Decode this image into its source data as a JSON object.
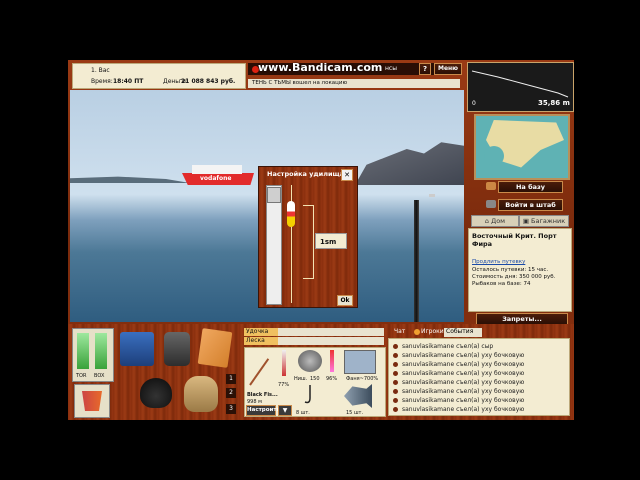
{
  "watermark": "www.Bandicam.com",
  "topbar": {
    "rank": "1. Вас",
    "time_label": "Время:",
    "time_value": "18:40 ПТ",
    "money_label": "Деньги:",
    "money_value": "21 088 843 руб.",
    "tab_partial": "нсы",
    "help_label": "?",
    "menu_label": "Меню",
    "event_line": "ТЕНЬ С ТЬМЫ вошел на локацию"
  },
  "depth": {
    "value": "35,86 m",
    "min": "0"
  },
  "map": {
    "to_base": "На базу",
    "to_hq": "Войти в штаб",
    "home_tab": "Дом",
    "luggage_tab": "Багажник"
  },
  "location": {
    "title": "Восточный Крит. Порт Фира",
    "extend_link": "Продлить путевку",
    "days_left": "Осталось путевки: 15 час.",
    "day_cost": "Стоимость дня: 350 000 руб.",
    "fishers": "Рыбаков на базе: 74",
    "bans_button": "Запреты..."
  },
  "float_dialog": {
    "title": "Настройка удилища",
    "depth_value": "1sm",
    "ok_label": "Ok",
    "close_label": "✕"
  },
  "inventory": {
    "bait_label_1": "TOR",
    "bait_label_2": "BOX",
    "slot_numbers": [
      "1",
      "2",
      "3"
    ]
  },
  "tackle": {
    "rod_tab": "Удочка",
    "line_tab": "Леска",
    "rod_percent": "77%",
    "reel_label": "Ниш.",
    "reel_value": "150",
    "reel_percent": "96%",
    "bait_name": "Фаня~700%",
    "rod_name": "Black Fis...",
    "rod_count": "998 м",
    "hook_label": "8 шт.",
    "fish_count": "15 шт.",
    "setup_button": "Настроить"
  },
  "chat": {
    "tabs": [
      "Чат",
      "Игроки",
      "События"
    ],
    "rows": [
      "sanuvlasikamane съел(а) сыр",
      "sanuvlasikamane съел(а) уху бочковую",
      "sanuvlasikamane съел(а) уху бочковую",
      "sanuvlasikamane съел(а) уху бочковую",
      "sanuvlasikamane съел(а) уху бочковую",
      "sanuvlasikamane съел(а) уху бочковую",
      "sanuvlasikamane съел(а) уху бочковую",
      "sanuvlasikamane съел(а) уху бочковую"
    ]
  },
  "colors": {
    "wood": "#8a2f0e",
    "paper": "#f3ecd2",
    "accent_orange": "#e07a1c"
  }
}
